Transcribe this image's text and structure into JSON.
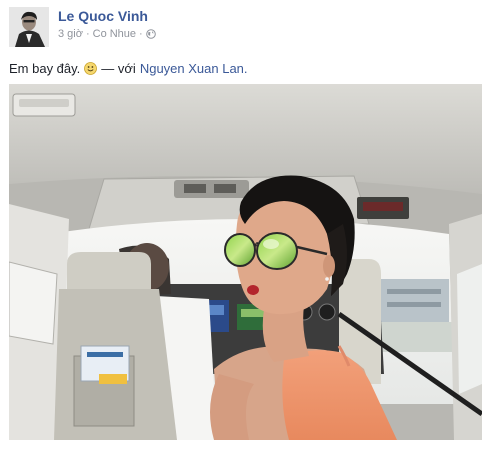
{
  "post": {
    "author": "Le Quoc Vinh",
    "time": "3 giờ",
    "separator": "·",
    "location": "Co Nhue",
    "separator2": "·",
    "text": "Em bay đây.",
    "with_text": "— với",
    "tagged_person": "Nguyen Xuan Lan."
  },
  "icons": {
    "avatar": "avatar",
    "privacy": "globe-icon",
    "emoji": "smile-icon"
  },
  "colors": {
    "link": "#3b5998",
    "meta": "#90949c",
    "text": "#1d2129"
  }
}
